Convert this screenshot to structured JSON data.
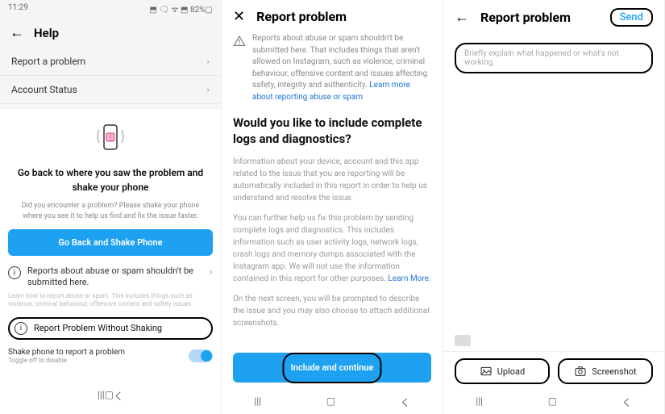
{
  "screen1": {
    "status": {
      "time": "11:29",
      "icons": "℗ ⬒ ⬒ ⬥",
      "right": "⬒ 🗨 ᯤ ⬒ 82%▢"
    },
    "title": "Help",
    "menu": [
      {
        "label": "Report a problem"
      },
      {
        "label": "Account Status"
      }
    ],
    "heading": "Go back to where you saw the problem and shake your phone",
    "sub": "Did you encounter a problem? Please shake your phone where you see it to help us find and fix the issue faster.",
    "button": "Go Back and Shake Phone",
    "info": "Reports about abuse or spam shouldn't be submitted here.",
    "info_desc": "Learn how to report abuse or spam. This includes things such as violence, criminal behaviour, offensive content and safety issues.",
    "report_without": "Report Problem Without Shaking",
    "toggle_label": "Shake phone to report a problem",
    "toggle_sub": "Toggle off to disable"
  },
  "screen2": {
    "title": "Report problem",
    "warning": "Reports about abuse or spam shouldn't be submitted here. That includes things that aren't allowed on Instagram, such as violence, criminal behaviour, offensive content and issues affecting safety, integrity and authenticity.",
    "warning_link": "Learn more about reporting abuse or spam",
    "heading": "Would you like to include complete logs and diagnostics?",
    "para1": "Information about your device, account and this app related to the issue that you are reporting will be automatically included in this report in order to help us understand and resolve the issue.",
    "para2": "You can further help us fix this problem by sending complete logs and diagnostics. This includes information such as user activity logs, network logs, crash logs and memory dumps associated with the Instagram app. We will not use the information contained in this report for other purposes.",
    "learn_more": "Learn More",
    "para3": "On the next screen, you will be prompted to describe the issue and you may also choose to attach additional screenshots.",
    "button": "Include and continue"
  },
  "screen3": {
    "title": "Report problem",
    "send": "Send",
    "placeholder": "Briefly explain what happened or what's not working.",
    "upload": "Upload",
    "screenshot": "Screenshot"
  }
}
